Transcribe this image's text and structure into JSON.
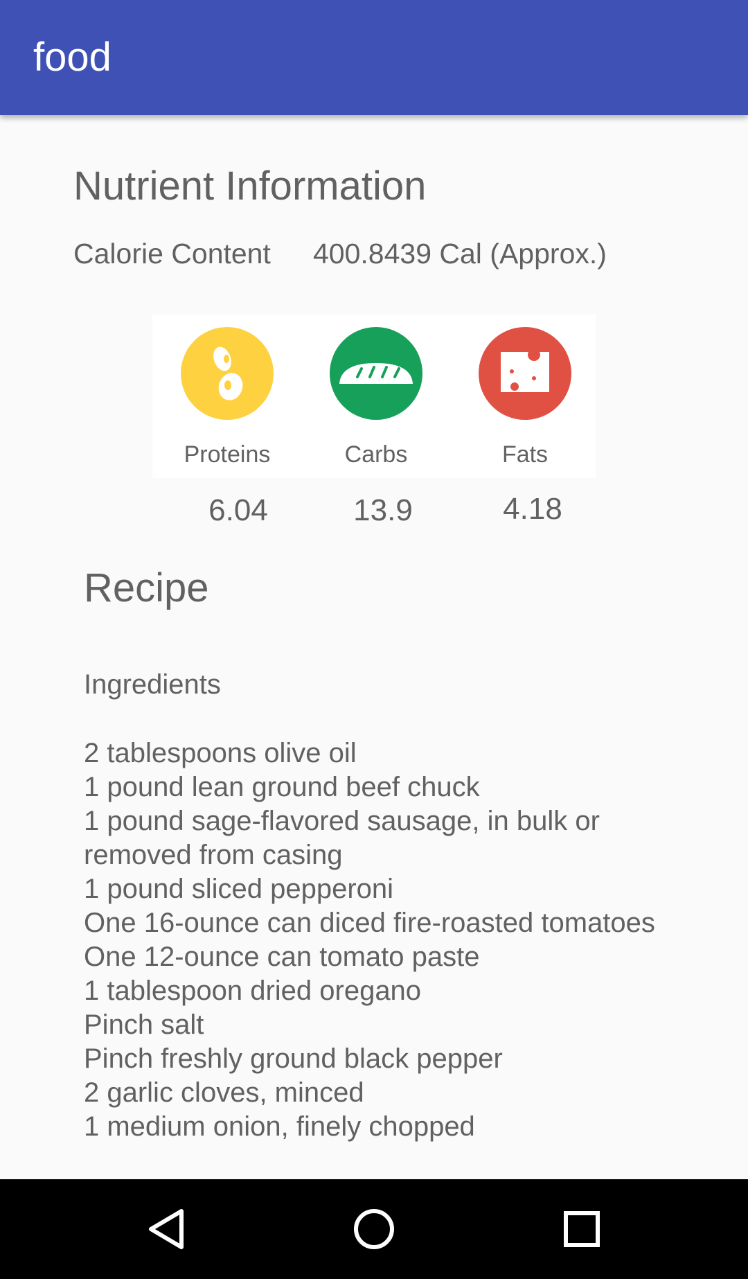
{
  "app_bar": {
    "title": "food",
    "color": "#3f51b5"
  },
  "nutrient_section": {
    "title": "Nutrient Information",
    "calorie_label": "Calorie Content",
    "calorie_value": "400.8439 Cal (Approx.)"
  },
  "macros": [
    {
      "label": "Proteins",
      "value": "6.04",
      "icon": "beans-icon",
      "color": "#fdd13f"
    },
    {
      "label": "Carbs",
      "value": "13.9",
      "icon": "bread-icon",
      "color": "#16a05a"
    },
    {
      "label": "Fats",
      "value": "4.18",
      "icon": "cheese-icon",
      "color": "#e05143"
    }
  ],
  "recipe": {
    "title": "Recipe",
    "ingredients_heading": "Ingredients",
    "ingredients": [
      "2 tablespoons olive oil",
      "1 pound lean ground beef chuck",
      "1 pound sage-flavored sausage, in bulk or",
      "removed from casing",
      "1 pound sliced pepperoni",
      "One 16-ounce can diced fire-roasted tomatoes",
      "One 12-ounce can tomato paste",
      "1 tablespoon dried oregano",
      "Pinch salt",
      "Pinch freshly ground black pepper",
      "2 garlic cloves, minced",
      "1 medium onion, finely chopped"
    ]
  },
  "nav_bar": {
    "back_icon": "back-triangle-icon",
    "home_icon": "home-circle-icon",
    "recents_icon": "recents-square-icon"
  }
}
